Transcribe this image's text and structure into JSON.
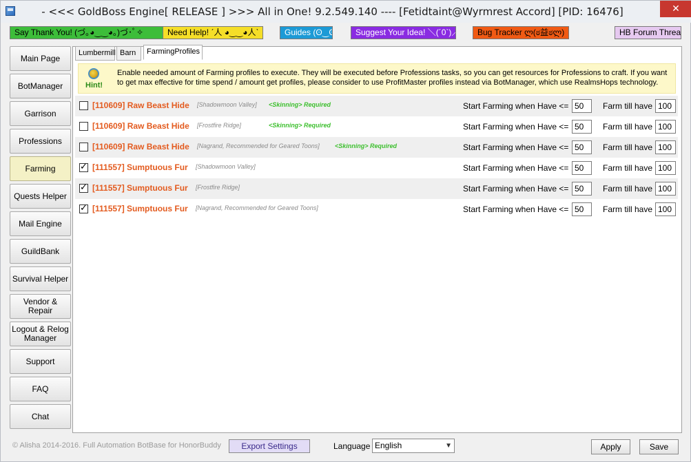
{
  "window": {
    "title": "- <<< GoldBoss Engine[ RELEASE ]  >>>  All in One! 9.2.549.140  ----  [Fetidtaint@Wyrmrest Accord] [PID: 16476]",
    "close_glyph": "✕"
  },
  "top_links": {
    "thanks": "Say Thank You! (づ｡◕‿‿◕｡)づ･ﾟ✧",
    "help": "Need Help! ˊ人 ◕‿‿◕人ˋ",
    "guides": "Guides (ʘ‿ʘ)",
    "suggest": "Suggest Your Idea! ＼(´0`)／",
    "bug": "Bug Tracker ლ(ಠ益ಠლ)",
    "forum": "HB Forum Thread"
  },
  "sidebar": {
    "items": [
      {
        "label": "Main Page"
      },
      {
        "label": "BotManager"
      },
      {
        "label": "Garrison"
      },
      {
        "label": "Professions"
      },
      {
        "label": "Farming"
      },
      {
        "label": "Quests Helper"
      },
      {
        "label": "Mail Engine"
      },
      {
        "label": "GuildBank"
      },
      {
        "label": "Survival Helper"
      },
      {
        "label": "Vendor & Repair"
      },
      {
        "label": "Logout & Relog Manager"
      },
      {
        "label": "Support"
      },
      {
        "label": "FAQ"
      },
      {
        "label": "Chat"
      }
    ],
    "active": "Farming"
  },
  "tabs": {
    "lumbermill": "Lumbermill",
    "barn": "Barn",
    "farming": "FarmingProfiles"
  },
  "hint": {
    "label": "Hint!",
    "text": "Enable needed amount of Farming profiles to execute. They will be executed before Professions tasks, so you can get resources for Professions to craft. If you want to get max effective for time spend / amount get profiles, please consider to use ProfitMaster profiles instead via BotManager, which use RealmsHops technology."
  },
  "profiles": [
    {
      "checked": false,
      "name": "[110609] Raw Beast Hide",
      "zone": "[Shadowmoon Valley]",
      "requirement": "<Skinning> Required",
      "start_label": "Start Farming when Have <=",
      "start_value": "50",
      "farm_label": "Farm till have",
      "farm_value": "100"
    },
    {
      "checked": false,
      "name": "[110609] Raw Beast Hide",
      "zone": "[Frostfire Ridge]",
      "requirement": "<Skinning> Required",
      "start_label": "Start Farming when Have <=",
      "start_value": "50",
      "farm_label": "Farm till have",
      "farm_value": "100"
    },
    {
      "checked": false,
      "name": "[110609] Raw Beast Hide",
      "zone": "[Nagrand, Recommended for Geared Toons]",
      "requirement": "<Skinning> Required",
      "start_label": "Start Farming when Have <=",
      "start_value": "50",
      "farm_label": "Farm till have",
      "farm_value": "100"
    },
    {
      "checked": true,
      "name": "[111557] Sumptuous Fur",
      "zone": "[Shadowmoon Valley]",
      "requirement": "",
      "start_label": "Start Farming when Have <=",
      "start_value": "50",
      "farm_label": "Farm till have",
      "farm_value": "100"
    },
    {
      "checked": true,
      "name": "[111557] Sumptuous Fur",
      "zone": "[Frostfire Ridge]",
      "requirement": "",
      "start_label": "Start Farming when Have <=",
      "start_value": "50",
      "farm_label": "Farm till have",
      "farm_value": "100"
    },
    {
      "checked": true,
      "name": "[111557] Sumptuous Fur",
      "zone": "[Nagrand, Recommended for Geared Toons]",
      "requirement": "",
      "start_label": "Start Farming when Have <=",
      "start_value": "50",
      "farm_label": "Farm till have",
      "farm_value": "100"
    }
  ],
  "footer": {
    "copyright": "© Alisha 2014-2016. Full Automation BotBase for HonorBuddy",
    "export_label": "Export Settings",
    "language_label": "Language",
    "language_value": "English",
    "apply_label": "Apply",
    "save_label": "Save"
  },
  "colors": {
    "profile_name": "#e35b1f",
    "requirement": "#3cbf2d",
    "active_sidebar": "#f4f1c6",
    "hint_bg": "#fdf8c9"
  }
}
